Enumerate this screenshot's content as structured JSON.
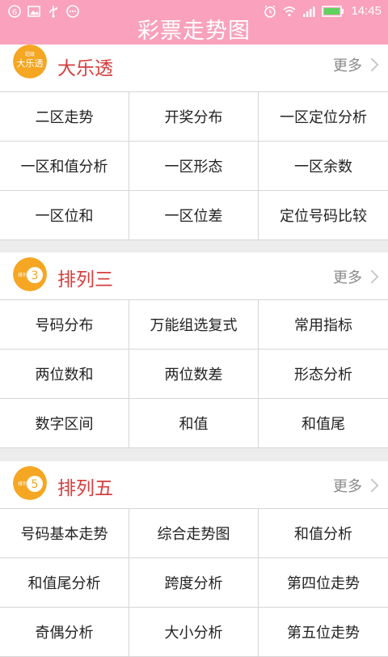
{
  "status_bar": {
    "left_icons": [
      "notification-6-icon",
      "image-icon",
      "usb-icon",
      "more-dots-icon"
    ],
    "right_icons": [
      "alarm-icon",
      "wifi-icon",
      "signal-icon",
      "battery-icon"
    ],
    "time": "14:45"
  },
  "header": {
    "title": "彩票走势图"
  },
  "sections": [
    {
      "title": "大乐透",
      "more": "更多",
      "logo_text": "超级 大乐透",
      "items": [
        [
          "二区走势",
          "开奖分布",
          "一区定位分析"
        ],
        [
          "一区和值分析",
          "一区形态",
          "一区余数"
        ],
        [
          "一区位和",
          "一区位差",
          "定位号码比较"
        ]
      ]
    },
    {
      "title": "排列三",
      "more": "更多",
      "logo_text": "排列 3",
      "items": [
        [
          "号码分布",
          "万能组选复式",
          "常用指标"
        ],
        [
          "两位数和",
          "两位数差",
          "形态分析"
        ],
        [
          "数字区间",
          "和值",
          "和值尾"
        ]
      ]
    },
    {
      "title": "排列五",
      "more": "更多",
      "logo_text": "排列 5",
      "items": [
        [
          "号码基本走势",
          "综合走势图",
          "和值分析"
        ],
        [
          "和值尾分析",
          "跨度分析",
          "第四位走势"
        ],
        [
          "奇偶分析",
          "大小分析",
          "第五位走势"
        ]
      ]
    }
  ],
  "colors": {
    "header": "#f9a1bd",
    "section_title": "#d63d3d",
    "logo": "#f5a623"
  }
}
